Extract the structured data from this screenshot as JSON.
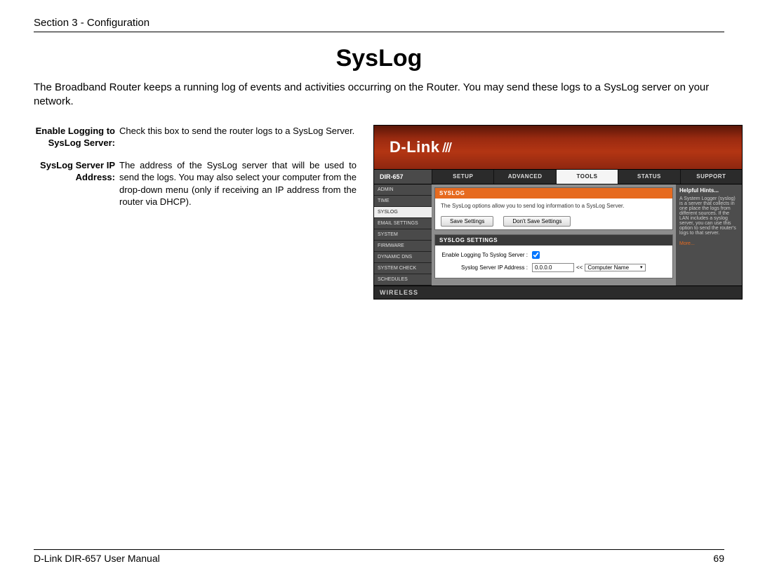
{
  "header": {
    "section": "Section 3 - Configuration"
  },
  "title": "SysLog",
  "intro": "The Broadband Router keeps a running log of events and activities occurring on the Router. You may send these logs to a SysLog server on your network.",
  "defs": [
    {
      "term": "Enable Logging to SysLog Server:",
      "desc": "Check this box to send the router logs to a SysLog Server."
    },
    {
      "term": "SysLog Server IP Address:",
      "desc": "The address of the SysLog server that will be used to send the logs. You may also select your computer from the drop-down menu (only if receiving an IP address from the router via DHCP)."
    }
  ],
  "screenshot": {
    "logo": "D-Link",
    "model": "DIR-657",
    "tabs": [
      "SETUP",
      "ADVANCED",
      "TOOLS",
      "STATUS",
      "SUPPORT"
    ],
    "activeTab": "TOOLS",
    "sidebar": [
      "ADMIN",
      "TIME",
      "SYSLOG",
      "EMAIL SETTINGS",
      "SYSTEM",
      "FIRMWARE",
      "DYNAMIC DNS",
      "SYSTEM CHECK",
      "SCHEDULES"
    ],
    "activeSidebar": "SYSLOG",
    "panelTitle": "SYSLOG",
    "panelDesc": "The SysLog options allow you to send log information to a SysLog Server.",
    "saveBtn": "Save Settings",
    "dontSaveBtn": "Don't Save Settings",
    "settingsTitle": "SYSLOG SETTINGS",
    "form": {
      "enableLabel": "Enable Logging To Syslog Server :",
      "ipLabel": "Syslog Server IP Address :",
      "ipValue": "0.0.0.0",
      "selectArrows": "<<",
      "selectValue": "Computer Name"
    },
    "hints": {
      "title": "Helpful Hints...",
      "body": "A System Logger (syslog) is a server that collects in one place the logs from different sources. If the LAN includes a syslog server, you can use this option to send the router's logs to that server.",
      "more": "More..."
    },
    "footer": "WIRELESS"
  },
  "footer": {
    "manual": "D-Link DIR-657 User Manual",
    "page": "69"
  }
}
